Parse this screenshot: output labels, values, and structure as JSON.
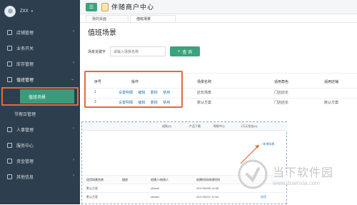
{
  "app": {
    "title": "伴随商户中心",
    "menu_button_icon": "hamburger-menu-icon",
    "accent": "#3aa37b",
    "highlight": "#e46a3c",
    "sidebar_bg": "#2d3e4e"
  },
  "user": {
    "name": "ZXX"
  },
  "tabs": [
    {
      "label": "我的桌面"
    },
    {
      "label": "值班场景"
    }
  ],
  "sidebar": {
    "items": [
      {
        "label": "店铺管理",
        "icon": "store-icon"
      },
      {
        "label": "业务开关",
        "icon": "toggle-icon"
      },
      {
        "label": "库存管理",
        "icon": "inventory-icon"
      },
      {
        "label": "值班管理",
        "icon": "schedule-icon",
        "expanded": true
      },
      {
        "label": "人事管理",
        "icon": "people-icon"
      },
      {
        "label": "服务中心",
        "icon": "service-icon"
      },
      {
        "label": "资金管理",
        "icon": "fund-icon"
      },
      {
        "label": "其他信息",
        "icon": "info-icon"
      }
    ],
    "sub_items": [
      {
        "label": "值班场景",
        "active": true
      },
      {
        "label": "节假日管理",
        "active": false
      }
    ]
  },
  "main": {
    "title": "值班场景",
    "search": {
      "label": "场景关键字",
      "placeholder": "请输入场景名称",
      "button": "查 询"
    },
    "table": {
      "headers": [
        "序号",
        "操作",
        "场景名称",
        "适用角色",
        "适用店铺"
      ],
      "rows": [
        {
          "seq": "1",
          "ops": [
            "设置明细",
            "编辑",
            "删除",
            "禁用"
          ],
          "name": "店长场景",
          "role": "门店店长",
          "plan": ""
        },
        {
          "seq": "2",
          "ops": [
            "设置明细",
            "编辑",
            "删除",
            "禁用"
          ],
          "name": "默认方案",
          "role": "门店店长",
          "plan": "默认方案"
        }
      ]
    }
  },
  "overlay": {
    "toolbar": [
      "退款(0)",
      "产品下载",
      "帮助中心",
      "1万元包含(0)"
    ],
    "add_link": "+ 新增场景",
    "table": {
      "headers": [
        "适用场景名称",
        "描述",
        "创建人/修改人",
        "创建时间/修改时间"
      ],
      "rows": [
        {
          "name": "默认方案",
          "desc": "",
          "creator": "zhiwei/",
          "time": "2017/06/06 14:08"
        },
        {
          "name": "默认方案",
          "desc": "",
          "creator": "zhiwei/",
          "time": "2017/06/07 10:03"
        }
      ],
      "row_actions": [
        "启用"
      ]
    }
  },
  "watermark": {
    "cn": "当下软件园",
    "url": "www.downxia.com"
  }
}
